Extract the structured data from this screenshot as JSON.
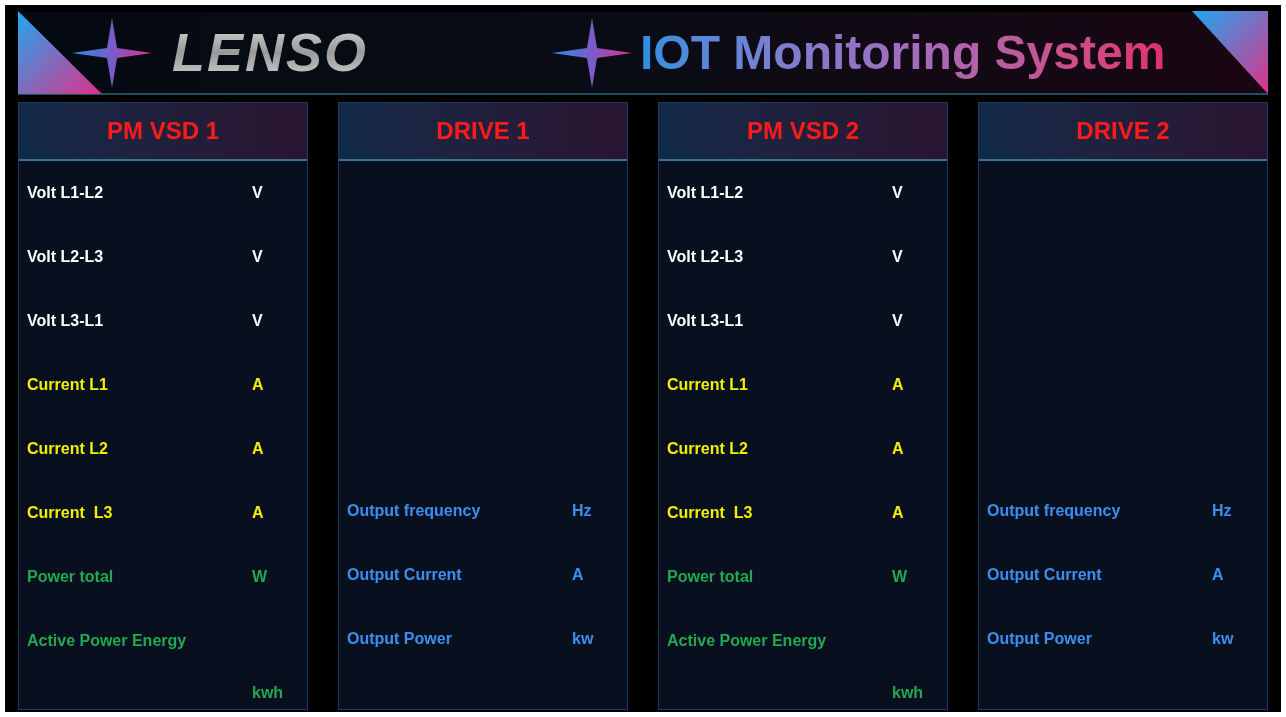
{
  "header": {
    "logo": "LENSO",
    "title": "IOT Monitoring System"
  },
  "panels": [
    {
      "title": "PM VSD 1",
      "kind": "meter",
      "rows": [
        {
          "kind": "volt",
          "label": "Volt L1-L2",
          "unit": "V"
        },
        {
          "kind": "volt",
          "label": "Volt L2-L3",
          "unit": "V"
        },
        {
          "kind": "volt",
          "label": "Volt L3-L1",
          "unit": "V"
        },
        {
          "kind": "current",
          "label": "Current L1",
          "unit": "A"
        },
        {
          "kind": "current",
          "label": "Current L2",
          "unit": "A"
        },
        {
          "kind": "current",
          "label": "Current  L3",
          "unit": "A"
        },
        {
          "kind": "power",
          "label": "Power total",
          "unit": "W"
        },
        {
          "kind": "energy",
          "label": "Active Power Energy",
          "unit": "kwh"
        }
      ]
    },
    {
      "title": "DRIVE 1",
      "kind": "drive",
      "rows": [
        {
          "kind": "drive",
          "label": "Output frequency",
          "unit": "Hz"
        },
        {
          "kind": "drive",
          "label": "Output Current",
          "unit": "A"
        },
        {
          "kind": "drive",
          "label": "Output Power",
          "unit": "kw"
        }
      ]
    },
    {
      "title": "PM VSD 2",
      "kind": "meter",
      "rows": [
        {
          "kind": "volt",
          "label": "Volt L1-L2",
          "unit": "V"
        },
        {
          "kind": "volt",
          "label": "Volt L2-L3",
          "unit": "V"
        },
        {
          "kind": "volt",
          "label": "Volt L3-L1",
          "unit": "V"
        },
        {
          "kind": "current",
          "label": "Current L1",
          "unit": "A"
        },
        {
          "kind": "current",
          "label": "Current L2",
          "unit": "A"
        },
        {
          "kind": "current",
          "label": "Current  L3",
          "unit": "A"
        },
        {
          "kind": "power",
          "label": "Power total",
          "unit": "W"
        },
        {
          "kind": "energy",
          "label": "Active Power Energy",
          "unit": "kwh"
        }
      ]
    },
    {
      "title": "DRIVE 2",
      "kind": "drive",
      "rows": [
        {
          "kind": "drive",
          "label": "Output frequency",
          "unit": "Hz"
        },
        {
          "kind": "drive",
          "label": "Output Current",
          "unit": "A"
        },
        {
          "kind": "drive",
          "label": "Output Power",
          "unit": "kw"
        }
      ]
    }
  ]
}
